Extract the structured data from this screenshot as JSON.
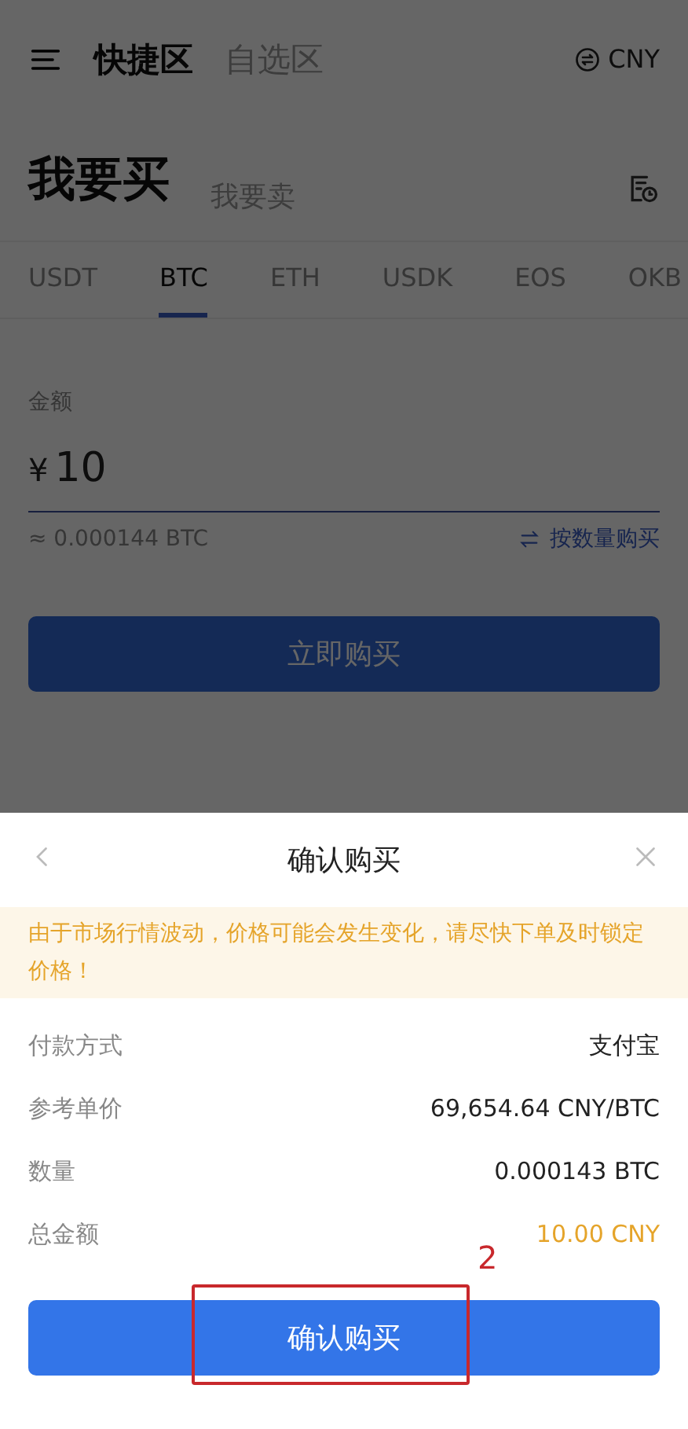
{
  "header": {
    "sections": [
      {
        "label": "快捷区",
        "selected": true
      },
      {
        "label": "自选区",
        "selected": false
      }
    ],
    "currency": "CNY"
  },
  "sides": [
    {
      "label": "我要买",
      "selected": true
    },
    {
      "label": "我要卖",
      "selected": false
    }
  ],
  "coins": [
    {
      "label": "USDT",
      "selected": false
    },
    {
      "label": "BTC",
      "selected": true
    },
    {
      "label": "ETH",
      "selected": false
    },
    {
      "label": "USDK",
      "selected": false
    },
    {
      "label": "EOS",
      "selected": false
    },
    {
      "label": "OKB",
      "selected": false
    }
  ],
  "amount": {
    "label": "金额",
    "symbol": "¥",
    "value": "10",
    "estimate": "≈ 0.000144 BTC",
    "switch_link": "按数量购买"
  },
  "buy_button": "立即购买",
  "dialog": {
    "title": "确认购买",
    "notice": "由于市场行情波动，价格可能会发生变化，请尽快下单及时锁定价格！",
    "rows": [
      {
        "label": "付款方式",
        "value": "支付宝",
        "highlight": false
      },
      {
        "label": "参考单价",
        "value": "69,654.64 CNY/BTC",
        "highlight": false
      },
      {
        "label": "数量",
        "value": "0.000143 BTC",
        "highlight": false
      },
      {
        "label": "总金额",
        "value": "10.00 CNY",
        "highlight": true
      }
    ],
    "confirm_button": "确认购买"
  },
  "annotation": {
    "label": "2"
  }
}
